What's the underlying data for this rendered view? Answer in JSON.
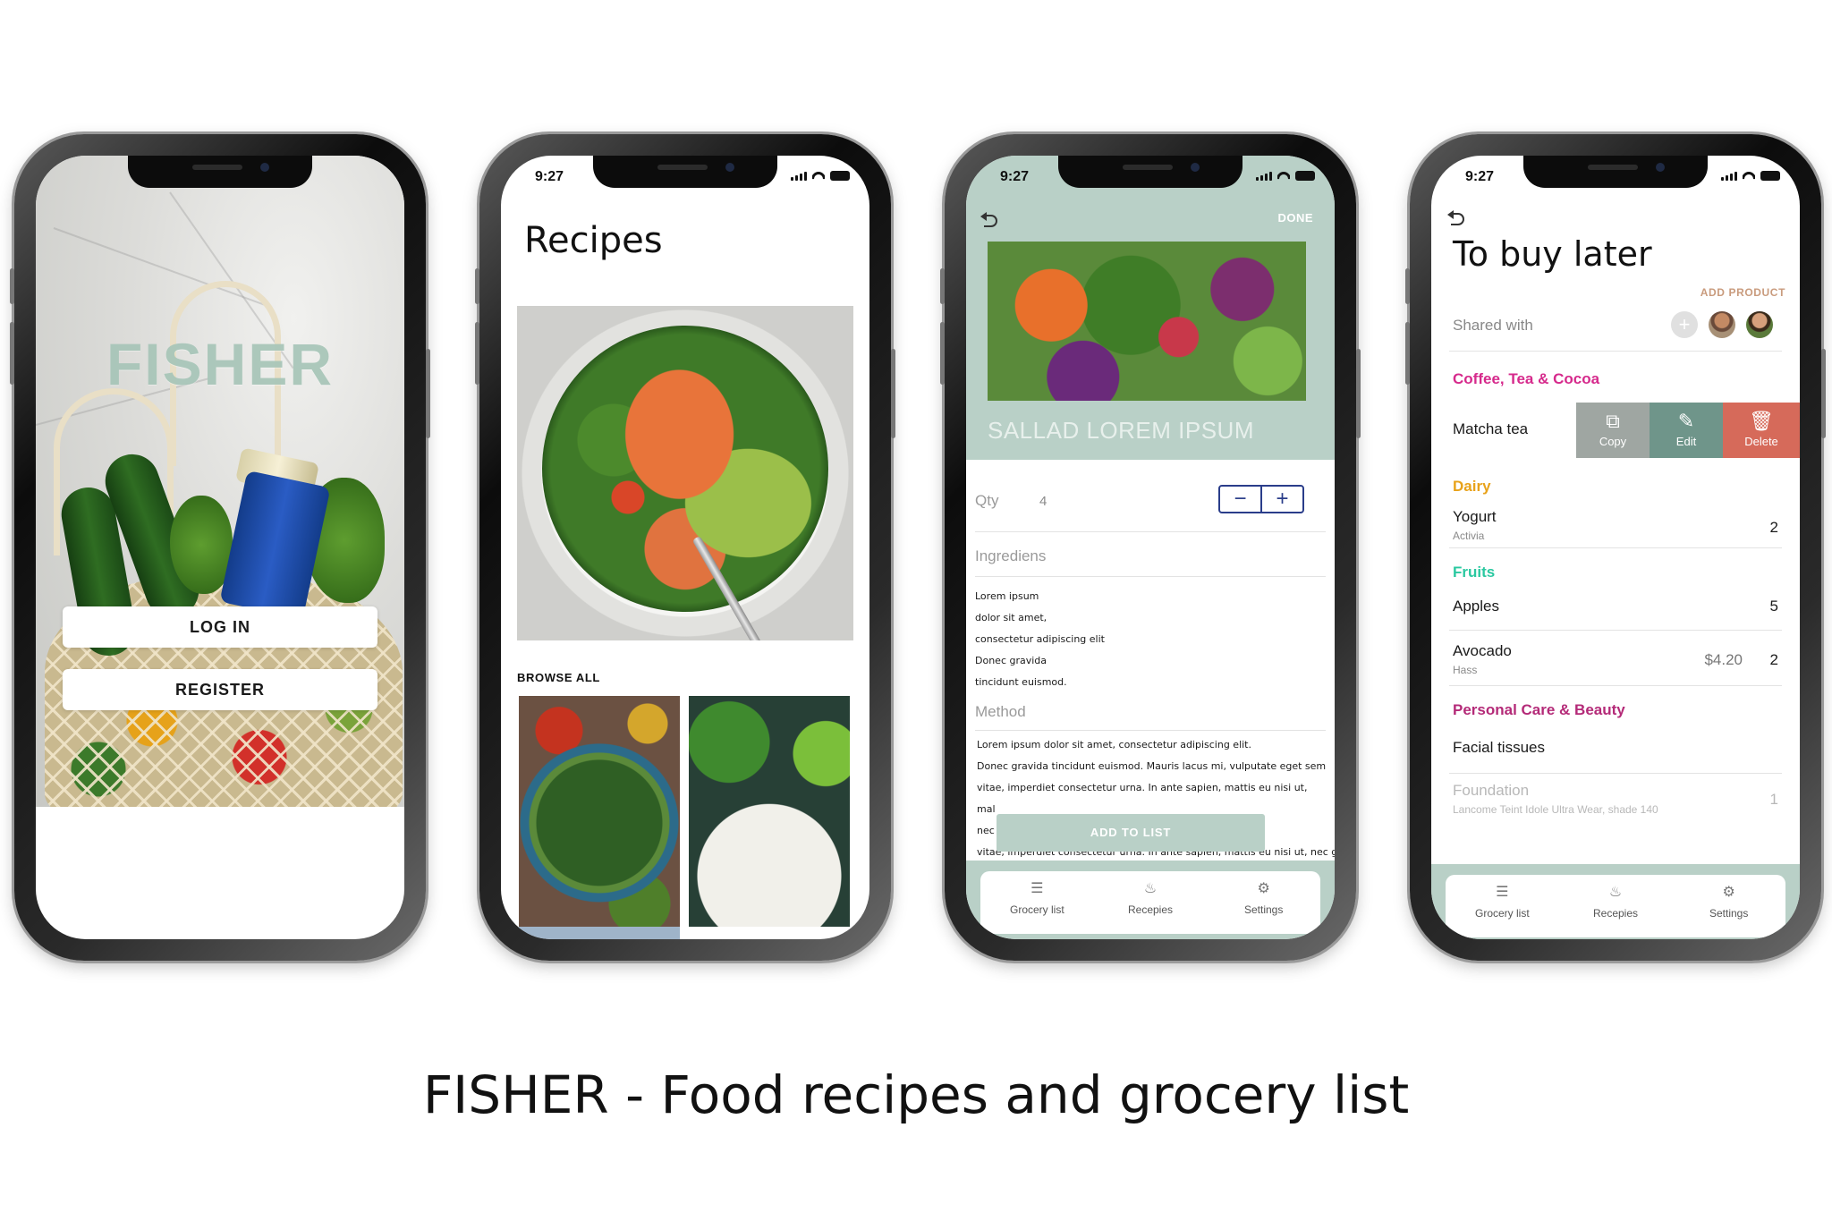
{
  "colors": {
    "sage": "#b9d0c7",
    "coffee_category": "#d62a8c",
    "dairy_category": "#e8a21a",
    "fruits_category": "#2ac8a0",
    "personal_care_category": "#b42a78",
    "copy_action": "#9fa6a2",
    "edit_action": "#6f958a",
    "delete_action": "#d66a5a",
    "add_product": "#c99b7d"
  },
  "status": {
    "time": "9:27"
  },
  "login": {
    "brand": "FISHER",
    "login_label": "LOG IN",
    "register_label": "REGISTER"
  },
  "recipes": {
    "title": "Recipes",
    "browse_all": "BROWSE ALL"
  },
  "detail": {
    "done_label": "DONE",
    "recipe_title": "SALLAD LOREM IPSUM",
    "qty_label": "Qty",
    "qty_value": "4",
    "minus": "−",
    "plus": "+",
    "ingredients_label": "Ingrediens",
    "ingredients": [
      "Lorem ipsum",
      "dolor sit amet,",
      "consectetur adipiscing elit",
      "Donec gravida",
      "tincidunt euismod."
    ],
    "method_label": "Method",
    "method_lines": [
      "Lorem ipsum dolor sit amet, consectetur adipiscing elit.",
      "Donec gravida tincidunt euismod. Mauris lacus mi, vulputate eget sem",
      "vitae, imperdiet consectetur urna. In ante sapien, mattis eu nisi ut,",
      "mal",
      "nec",
      "vitae, imperdiet consectetur urna. In ante sapien, mattis eu nisi ut, nec gravida"
    ],
    "add_to_list": "ADD TO LIST"
  },
  "tabs": [
    {
      "label": "Grocery list",
      "icon": "list-icon"
    },
    {
      "label": "Recepies",
      "icon": "pot-icon"
    },
    {
      "label": "Settings",
      "icon": "gear-icon"
    }
  ],
  "grocery": {
    "title": "To buy later",
    "add_product": "ADD PRODUCT",
    "shared_with": "Shared with",
    "actions": {
      "copy": "Copy",
      "edit": "Edit",
      "delete": "Delete"
    },
    "categories": [
      {
        "name": "Coffee, Tea & Cocoa",
        "items": [
          {
            "name": "Matcha tea"
          }
        ]
      },
      {
        "name": "Dairy",
        "items": [
          {
            "name": "Yogurt",
            "sub": "Activia",
            "qty": "2"
          }
        ]
      },
      {
        "name": "Fruits",
        "items": [
          {
            "name": "Apples",
            "qty": "5"
          },
          {
            "name": "Avocado",
            "sub": "Hass",
            "price": "$4.20",
            "qty": "2"
          }
        ]
      },
      {
        "name": "Personal Care & Beauty",
        "items": [
          {
            "name": "Facial tissues"
          },
          {
            "name": "Foundation",
            "sub": "Lancome Teint Idole Ultra Wear, shade 140",
            "qty": "1"
          }
        ]
      }
    ]
  },
  "caption": "FISHER - Food recipes and grocery list"
}
